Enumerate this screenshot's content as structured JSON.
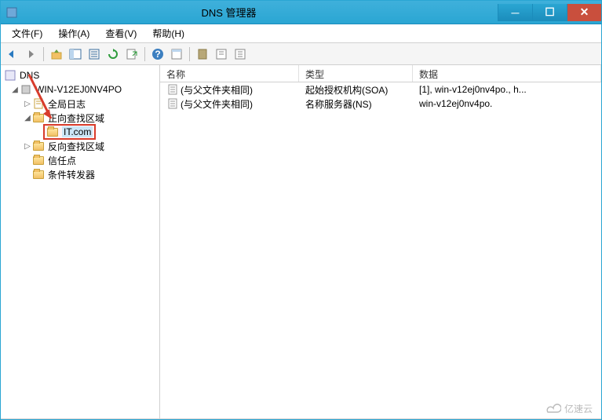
{
  "window": {
    "title": "DNS 管理器"
  },
  "menu": {
    "file": "文件(F)",
    "action": "操作(A)",
    "view": "查看(V)",
    "help": "帮助(H)"
  },
  "tree": {
    "root": "DNS",
    "server": "WIN-V12EJ0NV4PO",
    "global_log": "全局日志",
    "fwd_zone": "正向查找区域",
    "zone_it": "IT.com",
    "rev_zone": "反向查找区域",
    "trust": "信任点",
    "fwders": "条件转发器"
  },
  "columns": {
    "name": "名称",
    "type": "类型",
    "data": "数据"
  },
  "records": [
    {
      "name": "(与父文件夹相同)",
      "type": "起始授权机构(SOA)",
      "data": "[1], win-v12ej0nv4po., h..."
    },
    {
      "name": "(与父文件夹相同)",
      "type": "名称服务器(NS)",
      "data": "win-v12ej0nv4po."
    }
  ],
  "watermark": "亿速云"
}
